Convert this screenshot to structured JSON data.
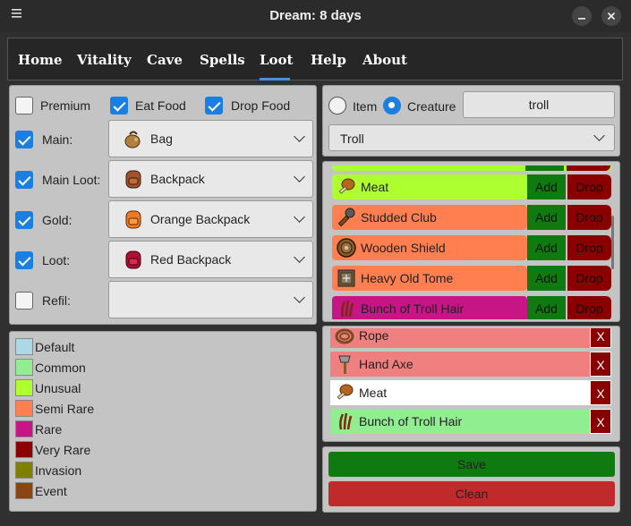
{
  "window": {
    "title": "Dream: 8 days"
  },
  "nav": {
    "tabs": [
      {
        "label": "Home"
      },
      {
        "label": "Vitality"
      },
      {
        "label": "Cave"
      },
      {
        "label": "Spells"
      },
      {
        "label": "Loot"
      },
      {
        "label": "Help"
      },
      {
        "label": "About"
      }
    ],
    "active": "Loot"
  },
  "options": {
    "premium": {
      "label": "Premium",
      "checked": false
    },
    "eat_food": {
      "label": "Eat Food",
      "checked": true
    },
    "drop_food": {
      "label": "Drop Food",
      "checked": true
    }
  },
  "containers": [
    {
      "label": "Main:",
      "checked": true,
      "value": "Bag",
      "icon": "bag-icon"
    },
    {
      "label": "Main Loot:",
      "checked": true,
      "value": "Backpack",
      "icon": "backpack-icon"
    },
    {
      "label": "Gold:",
      "checked": true,
      "value": "Orange Backpack",
      "icon": "orange-backpack-icon"
    },
    {
      "label": "Loot:",
      "checked": true,
      "value": "Red Backpack",
      "icon": "red-backpack-icon"
    },
    {
      "label": "Refil:",
      "checked": false,
      "value": "",
      "icon": ""
    }
  ],
  "legend": [
    {
      "label": "Default",
      "color": "#add8e6"
    },
    {
      "label": "Common",
      "color": "#90ee90"
    },
    {
      "label": "Unusual",
      "color": "#adff2f"
    },
    {
      "label": "Semi Rare",
      "color": "#ff7f50"
    },
    {
      "label": "Rare",
      "color": "#c71585"
    },
    {
      "label": "Very Rare",
      "color": "#8b0000"
    },
    {
      "label": "Invasion",
      "color": "#808000"
    },
    {
      "label": "Event",
      "color": "#8b4513"
    }
  ],
  "search": {
    "item_label": "Item",
    "creature_label": "Creature",
    "mode": "Creature",
    "query": "troll",
    "creature_select": "Troll"
  },
  "creature_loot": [
    {
      "name": "Meat",
      "color": "#adff2f",
      "icon": "meat-icon"
    },
    {
      "name": "Studded Club",
      "color": "#ff7f50",
      "icon": "club-icon"
    },
    {
      "name": "Wooden Shield",
      "color": "#ff7f50",
      "icon": "shield-icon"
    },
    {
      "name": "Heavy Old Tome",
      "color": "#ff7f50",
      "icon": "tome-icon"
    },
    {
      "name": "Bunch of Troll Hair",
      "color": "#c71585",
      "icon": "troll-hair-icon"
    }
  ],
  "loot_buttons": {
    "add": "Add",
    "drop": "Drop"
  },
  "selected_loot": [
    {
      "name": "Rope",
      "color": "#f08080",
      "icon": "rope-icon"
    },
    {
      "name": "Hand Axe",
      "color": "#f08080",
      "icon": "axe-icon"
    },
    {
      "name": "Meat",
      "color": "#ffffff",
      "icon": "meat-icon"
    },
    {
      "name": "Bunch of Troll Hair",
      "color": "#90ee90",
      "icon": "troll-hair-icon"
    }
  ],
  "remove_label": "X",
  "actions": {
    "save": "Save",
    "clean": "Clean"
  }
}
